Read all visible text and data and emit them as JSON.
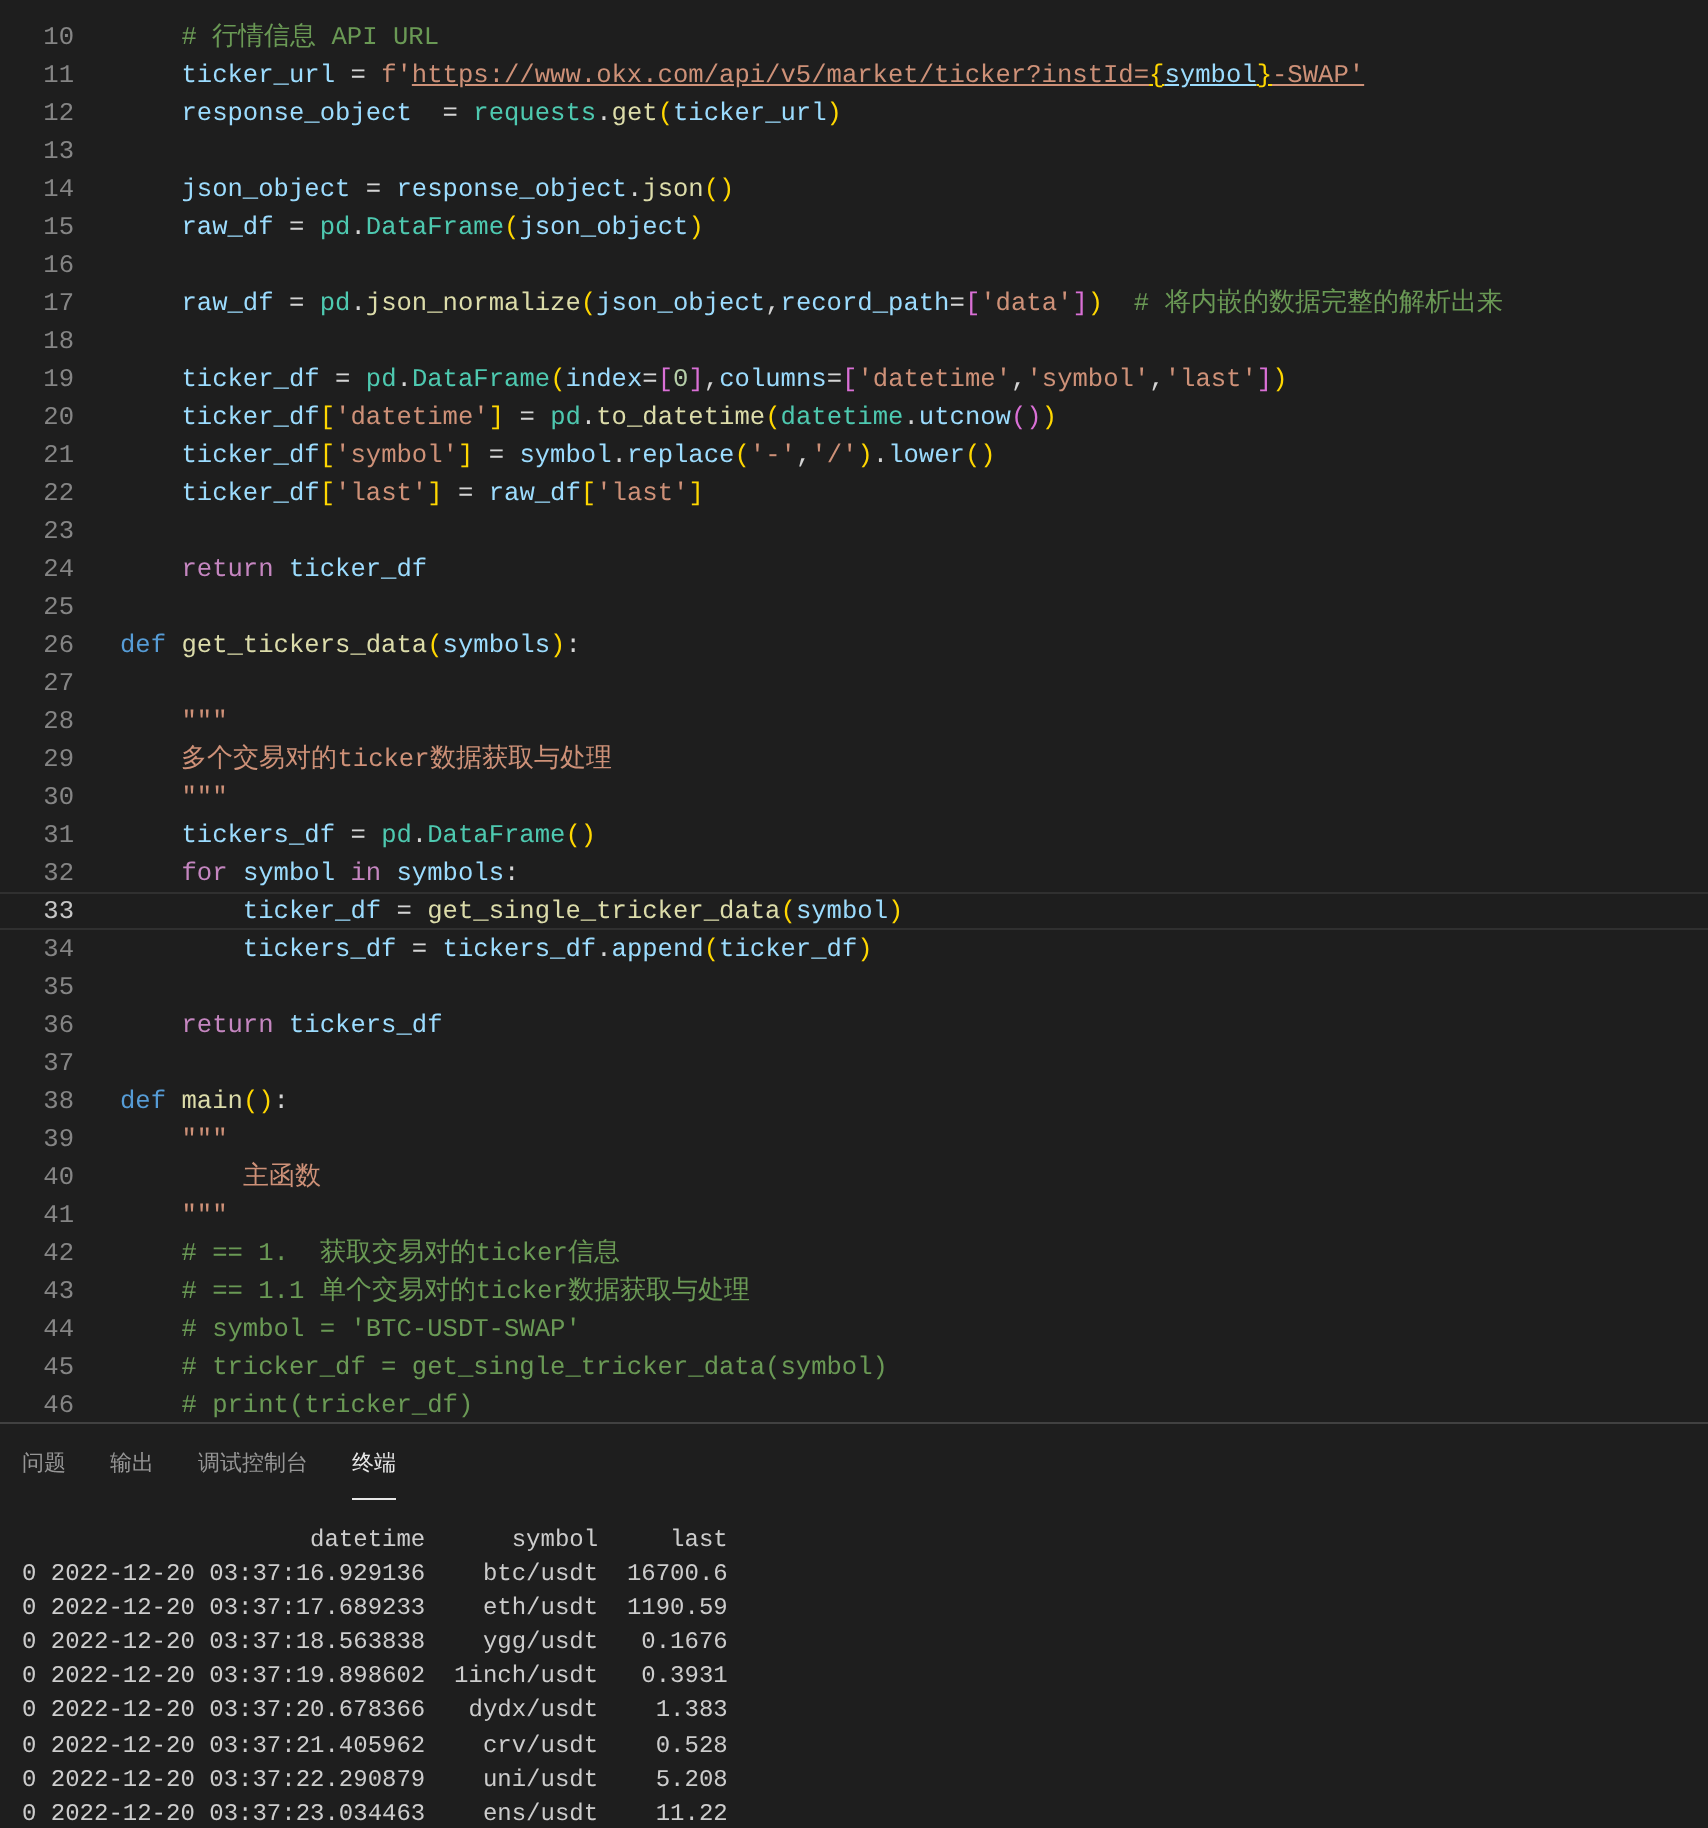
{
  "editor": {
    "lines": [
      {
        "number": "10",
        "current": false,
        "tokens": [
          {
            "kind": "c",
            "text": "    # 行情信息 API URL"
          }
        ]
      },
      {
        "number": "11",
        "current": false,
        "tokens": [
          {
            "kind": "v",
            "text": "    ticker_url"
          },
          {
            "kind": "o",
            "text": " = "
          },
          {
            "kind": "s",
            "text": "f'"
          },
          {
            "kind": "su",
            "text": "https://www.okx.com/api/v5/market/ticker?instId="
          },
          {
            "kind": "b1u",
            "text": "{"
          },
          {
            "kind": "vu",
            "text": "symbol"
          },
          {
            "kind": "b1u",
            "text": "}"
          },
          {
            "kind": "su",
            "text": "-SWAP'"
          }
        ]
      },
      {
        "number": "12",
        "current": false,
        "tokens": [
          {
            "kind": "v",
            "text": "    response_object"
          },
          {
            "kind": "o",
            "text": "  = "
          },
          {
            "kind": "cl",
            "text": "requests"
          },
          {
            "kind": "o",
            "text": "."
          },
          {
            "kind": "f",
            "text": "get"
          },
          {
            "kind": "b1",
            "text": "("
          },
          {
            "kind": "v",
            "text": "ticker_url"
          },
          {
            "kind": "b1",
            "text": ")"
          }
        ]
      },
      {
        "number": "13",
        "current": false
      },
      {
        "number": "14",
        "current": false,
        "tokens": [
          {
            "kind": "v",
            "text": "    json_object"
          },
          {
            "kind": "o",
            "text": " = "
          },
          {
            "kind": "v",
            "text": "response_object"
          },
          {
            "kind": "o",
            "text": "."
          },
          {
            "kind": "f",
            "text": "json"
          },
          {
            "kind": "b1",
            "text": "()"
          }
        ]
      },
      {
        "number": "15",
        "current": false,
        "tokens": [
          {
            "kind": "v",
            "text": "    raw_df"
          },
          {
            "kind": "o",
            "text": " = "
          },
          {
            "kind": "cl",
            "text": "pd"
          },
          {
            "kind": "o",
            "text": "."
          },
          {
            "kind": "cl",
            "text": "DataFrame"
          },
          {
            "kind": "b1",
            "text": "("
          },
          {
            "kind": "v",
            "text": "json_object"
          },
          {
            "kind": "b1",
            "text": ")"
          }
        ]
      },
      {
        "number": "16",
        "current": false
      },
      {
        "number": "17",
        "current": false,
        "tokens": [
          {
            "kind": "v",
            "text": "    raw_df"
          },
          {
            "kind": "o",
            "text": " = "
          },
          {
            "kind": "cl",
            "text": "pd"
          },
          {
            "kind": "o",
            "text": "."
          },
          {
            "kind": "f",
            "text": "json_normalize"
          },
          {
            "kind": "b1",
            "text": "("
          },
          {
            "kind": "v",
            "text": "json_object"
          },
          {
            "kind": "o",
            "text": ","
          },
          {
            "kind": "v",
            "text": "record_path"
          },
          {
            "kind": "o",
            "text": "="
          },
          {
            "kind": "b2",
            "text": "["
          },
          {
            "kind": "s",
            "text": "'data'"
          },
          {
            "kind": "b2",
            "text": "]"
          },
          {
            "kind": "b1",
            "text": ")"
          },
          {
            "kind": "c",
            "text": "  # 将内嵌的数据完整的解析出来"
          }
        ]
      },
      {
        "number": "18",
        "current": false
      },
      {
        "number": "19",
        "current": false,
        "tokens": [
          {
            "kind": "v",
            "text": "    ticker_df"
          },
          {
            "kind": "o",
            "text": " = "
          },
          {
            "kind": "cl",
            "text": "pd"
          },
          {
            "kind": "o",
            "text": "."
          },
          {
            "kind": "cl",
            "text": "DataFrame"
          },
          {
            "kind": "b1",
            "text": "("
          },
          {
            "kind": "v",
            "text": "index"
          },
          {
            "kind": "o",
            "text": "="
          },
          {
            "kind": "b2",
            "text": "["
          },
          {
            "kind": "n",
            "text": "0"
          },
          {
            "kind": "b2",
            "text": "]"
          },
          {
            "kind": "o",
            "text": ","
          },
          {
            "kind": "v",
            "text": "columns"
          },
          {
            "kind": "o",
            "text": "="
          },
          {
            "kind": "b2",
            "text": "["
          },
          {
            "kind": "s",
            "text": "'datetime'"
          },
          {
            "kind": "o",
            "text": ","
          },
          {
            "kind": "s",
            "text": "'symbol'"
          },
          {
            "kind": "o",
            "text": ","
          },
          {
            "kind": "s",
            "text": "'last'"
          },
          {
            "kind": "b2",
            "text": "]"
          },
          {
            "kind": "b1",
            "text": ")"
          }
        ]
      },
      {
        "number": "20",
        "current": false,
        "tokens": [
          {
            "kind": "v",
            "text": "    ticker_df"
          },
          {
            "kind": "b1",
            "text": "["
          },
          {
            "kind": "s",
            "text": "'datetime'"
          },
          {
            "kind": "b1",
            "text": "]"
          },
          {
            "kind": "o",
            "text": " = "
          },
          {
            "kind": "cl",
            "text": "pd"
          },
          {
            "kind": "o",
            "text": "."
          },
          {
            "kind": "f",
            "text": "to_datetime"
          },
          {
            "kind": "b1",
            "text": "("
          },
          {
            "kind": "cl",
            "text": "datetime"
          },
          {
            "kind": "o",
            "text": "."
          },
          {
            "kind": "v",
            "text": "utcnow"
          },
          {
            "kind": "b2",
            "text": "()"
          },
          {
            "kind": "b1",
            "text": ")"
          }
        ]
      },
      {
        "number": "21",
        "current": false,
        "tokens": [
          {
            "kind": "v",
            "text": "    ticker_df"
          },
          {
            "kind": "b1",
            "text": "["
          },
          {
            "kind": "s",
            "text": "'symbol'"
          },
          {
            "kind": "b1",
            "text": "]"
          },
          {
            "kind": "o",
            "text": " = "
          },
          {
            "kind": "v",
            "text": "symbol"
          },
          {
            "kind": "o",
            "text": "."
          },
          {
            "kind": "v",
            "text": "replace"
          },
          {
            "kind": "b1",
            "text": "("
          },
          {
            "kind": "s",
            "text": "'-'"
          },
          {
            "kind": "o",
            "text": ","
          },
          {
            "kind": "s",
            "text": "'/'"
          },
          {
            "kind": "b1",
            "text": ")"
          },
          {
            "kind": "o",
            "text": "."
          },
          {
            "kind": "v",
            "text": "lower"
          },
          {
            "kind": "b1",
            "text": "()"
          }
        ]
      },
      {
        "number": "22",
        "current": false,
        "tokens": [
          {
            "kind": "v",
            "text": "    ticker_df"
          },
          {
            "kind": "b1",
            "text": "["
          },
          {
            "kind": "s",
            "text": "'last'"
          },
          {
            "kind": "b1",
            "text": "]"
          },
          {
            "kind": "o",
            "text": " = "
          },
          {
            "kind": "v",
            "text": "raw_df"
          },
          {
            "kind": "b1",
            "text": "["
          },
          {
            "kind": "s",
            "text": "'last'"
          },
          {
            "kind": "b1",
            "text": "]"
          }
        ]
      },
      {
        "number": "23",
        "current": false
      },
      {
        "number": "24",
        "current": false,
        "tokens": [
          {
            "kind": "k",
            "text": "    return "
          },
          {
            "kind": "v",
            "text": "ticker_df"
          }
        ]
      },
      {
        "number": "25",
        "current": false
      },
      {
        "number": "26",
        "current": false,
        "tokens": [
          {
            "kind": "d",
            "text": "def "
          },
          {
            "kind": "f",
            "text": "get_tickers_data"
          },
          {
            "kind": "b1",
            "text": "("
          },
          {
            "kind": "v",
            "text": "symbols"
          },
          {
            "kind": "b1",
            "text": ")"
          },
          {
            "kind": "o",
            "text": ":"
          }
        ]
      },
      {
        "number": "27",
        "current": false
      },
      {
        "number": "28",
        "current": false,
        "tokens": [
          {
            "kind": "s",
            "text": "    \"\"\""
          }
        ]
      },
      {
        "number": "29",
        "current": false,
        "tokens": [
          {
            "kind": "s",
            "text": "    多个交易对的ticker数据获取与处理"
          }
        ]
      },
      {
        "number": "30",
        "current": false,
        "tokens": [
          {
            "kind": "s",
            "text": "    \"\"\""
          }
        ]
      },
      {
        "number": "31",
        "current": false,
        "tokens": [
          {
            "kind": "v",
            "text": "    tickers_df"
          },
          {
            "kind": "o",
            "text": " = "
          },
          {
            "kind": "cl",
            "text": "pd"
          },
          {
            "kind": "o",
            "text": "."
          },
          {
            "kind": "cl",
            "text": "DataFrame"
          },
          {
            "kind": "b1",
            "text": "()"
          }
        ]
      },
      {
        "number": "32",
        "current": false,
        "tokens": [
          {
            "kind": "k",
            "text": "    for "
          },
          {
            "kind": "v",
            "text": "symbol "
          },
          {
            "kind": "k",
            "text": "in "
          },
          {
            "kind": "v",
            "text": "symbols"
          },
          {
            "kind": "o",
            "text": ":"
          }
        ]
      },
      {
        "number": "33",
        "current": true,
        "tokens": [
          {
            "kind": "v",
            "text": "        ticker_df"
          },
          {
            "kind": "o",
            "text": " = "
          },
          {
            "kind": "f",
            "text": "get_single_tricker_data"
          },
          {
            "kind": "b1",
            "text": "("
          },
          {
            "kind": "v",
            "text": "symbol"
          },
          {
            "kind": "b1",
            "text": ")"
          }
        ]
      },
      {
        "number": "34",
        "current": false,
        "tokens": [
          {
            "kind": "v",
            "text": "        tickers_df"
          },
          {
            "kind": "o",
            "text": " = "
          },
          {
            "kind": "v",
            "text": "tickers_df"
          },
          {
            "kind": "o",
            "text": "."
          },
          {
            "kind": "v",
            "text": "append"
          },
          {
            "kind": "b1",
            "text": "("
          },
          {
            "kind": "v",
            "text": "ticker_df"
          },
          {
            "kind": "b1",
            "text": ")"
          }
        ]
      },
      {
        "number": "35",
        "current": false
      },
      {
        "number": "36",
        "current": false,
        "tokens": [
          {
            "kind": "k",
            "text": "    return "
          },
          {
            "kind": "v",
            "text": "tickers_df"
          }
        ]
      },
      {
        "number": "37",
        "current": false
      },
      {
        "number": "38",
        "current": false,
        "tokens": [
          {
            "kind": "d",
            "text": "def "
          },
          {
            "kind": "f",
            "text": "main"
          },
          {
            "kind": "b1",
            "text": "()"
          },
          {
            "kind": "o",
            "text": ":"
          }
        ]
      },
      {
        "number": "39",
        "current": false,
        "tokens": [
          {
            "kind": "s",
            "text": "    \"\"\""
          }
        ]
      },
      {
        "number": "40",
        "current": false,
        "tokens": [
          {
            "kind": "s",
            "text": "        主函数"
          }
        ]
      },
      {
        "number": "41",
        "current": false,
        "tokens": [
          {
            "kind": "s",
            "text": "    \"\"\""
          }
        ]
      },
      {
        "number": "42",
        "current": false,
        "tokens": [
          {
            "kind": "c",
            "text": "    # == 1.  获取交易对的ticker信息"
          }
        ]
      },
      {
        "number": "43",
        "current": false,
        "tokens": [
          {
            "kind": "c",
            "text": "    # == 1.1 单个交易对的ticker数据获取与处理"
          }
        ]
      },
      {
        "number": "44",
        "current": false,
        "tokens": [
          {
            "kind": "c",
            "text": "    # symbol = 'BTC-USDT-SWAP'"
          }
        ]
      },
      {
        "number": "45",
        "current": false,
        "tokens": [
          {
            "kind": "c",
            "text": "    # tricker_df = get_single_tricker_data(symbol)"
          }
        ]
      },
      {
        "number": "46",
        "current": false,
        "tokens": [
          {
            "kind": "c",
            "text": "    # print(tricker_df)"
          }
        ]
      }
    ]
  },
  "panel": {
    "tabs": [
      {
        "label": "问题",
        "selected": false
      },
      {
        "label": "输出",
        "selected": false
      },
      {
        "label": "调试控制台",
        "selected": false
      },
      {
        "label": "终端",
        "selected": true
      }
    ],
    "terminal_lines": [
      "                    datetime      symbol     last",
      "0 2022-12-20 03:37:16.929136    btc/usdt  16700.6",
      "0 2022-12-20 03:37:17.689233    eth/usdt  1190.59",
      "0 2022-12-20 03:37:18.563838    ygg/usdt   0.1676",
      "0 2022-12-20 03:37:19.898602  1inch/usdt   0.3931",
      "0 2022-12-20 03:37:20.678366   dydx/usdt    1.383",
      "0 2022-12-20 03:37:21.405962    crv/usdt    0.528",
      "0 2022-12-20 03:37:22.290879    uni/usdt    5.208",
      "0 2022-12-20 03:37:23.034463    ens/usdt    11.22"
    ]
  }
}
